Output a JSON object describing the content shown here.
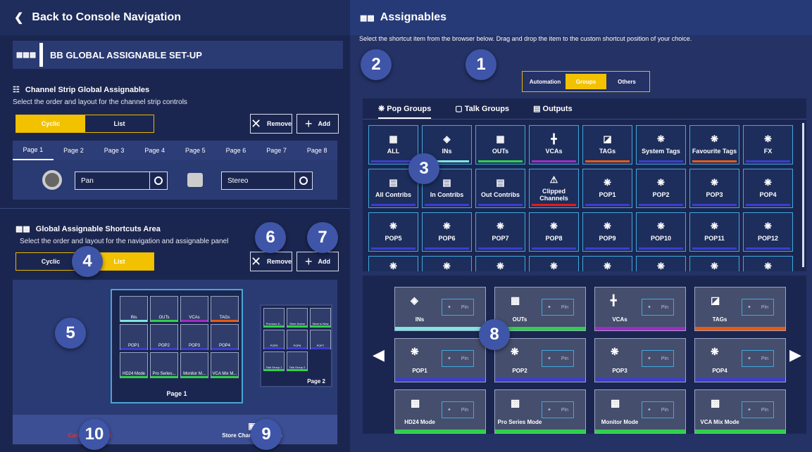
{
  "left": {
    "back_label": "Back to Console Navigation",
    "section_title": "BB GLOBAL ASSIGNABLE SET-UP",
    "channel_strip": {
      "title": "Channel Strip Global Assignables",
      "subtitle": "Select the order and layout for the channel strip controls",
      "cyclic": "Cyclic",
      "list": "List",
      "remove": "Remove",
      "add": "Add",
      "pages": [
        "Page 1",
        "Page 2",
        "Page 3",
        "Page 4",
        "Page 5",
        "Page 6",
        "Page 7",
        "Page 8"
      ],
      "control1": "Pan",
      "control2": "Stereo"
    },
    "shortcuts": {
      "title": "Global Assignable Shortcuts Area",
      "subtitle": "Select the order and layout for the navigation and assignable panel",
      "cyclic": "Cyclic",
      "list": "List",
      "remove": "Remove",
      "add": "Add",
      "page1_label": "Page 1",
      "page2_label": "Page 2",
      "page1_items": [
        "INs",
        "OUTs",
        "VCAs",
        "TAGs",
        "POP1",
        "POP2",
        "POP3",
        "POP4",
        "HD24 Mode",
        "Pro Series...",
        "Monitor M...",
        "VCA Mix M..."
      ],
      "page2_items": [
        "Previous S...",
        "Store Scene",
        "Store to New",
        "POP5",
        "POP6",
        "POP7",
        "Talk Group 1",
        "Talk Group 2"
      ]
    },
    "footer": {
      "cancel": "Cancel Changes",
      "save": "Store Changes & Save"
    }
  },
  "right": {
    "title": "Assignables",
    "instructions": "Select the shortcut item from the browser below. Drag and drop the item to the custom shortcut position of your choice.",
    "groups_toggle": [
      "Automation",
      "Groups",
      "Others"
    ],
    "browser_tabs": [
      "Pop Groups",
      "Talk Groups",
      "Outputs"
    ],
    "tiles": [
      "ALL",
      "INs",
      "OUTs",
      "VCAs",
      "TAGs",
      "System Tags",
      "Favourite Tags",
      "FX",
      "All Contribs",
      "In Contribs",
      "Out Contribs",
      "Clipped Channels",
      "POP1",
      "POP2",
      "POP3",
      "POP4",
      "POP5",
      "POP6",
      "POP7",
      "POP8",
      "POP9",
      "POP10",
      "POP11",
      "POP12"
    ],
    "panel_items": [
      "INs",
      "OUTs",
      "VCAs",
      "TAGs",
      "POP1",
      "POP2",
      "POP3",
      "POP4",
      "HD24 Mode",
      "Pro Series Mode",
      "Monitor Mode",
      "VCA Mix Mode"
    ],
    "pin_label": "Pin"
  },
  "callouts": [
    "1",
    "2",
    "3",
    "4",
    "5",
    "6",
    "7",
    "8",
    "9",
    "10"
  ]
}
